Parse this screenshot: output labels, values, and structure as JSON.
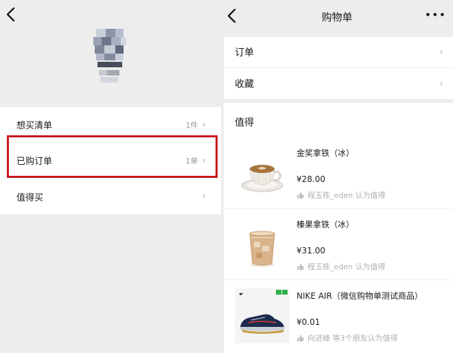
{
  "left": {
    "menu": [
      {
        "label": "想买清单",
        "count": "1件"
      },
      {
        "label": "已购订单",
        "count": "1单"
      },
      {
        "label": "值得买",
        "count": ""
      }
    ]
  },
  "right": {
    "title": "购物单",
    "more": "•••",
    "menu": [
      {
        "label": "订单"
      },
      {
        "label": "收藏"
      }
    ],
    "section_title": "值得",
    "products": [
      {
        "name": "金奖拿铁（冰）",
        "price": "¥28.00",
        "rec": "程玉栋_eden  认为值得"
      },
      {
        "name": "榛果拿铁（冰）",
        "price": "¥31.00",
        "rec": "程玉栋_eden  认为值得"
      },
      {
        "name": "NIKE AIR（微信购物单测试商品）",
        "price": "¥0.01",
        "rec": "向进峰  等3个朋友认为值得"
      }
    ]
  },
  "colors": {
    "highlight": "#c8161d",
    "background": "#ededed"
  }
}
